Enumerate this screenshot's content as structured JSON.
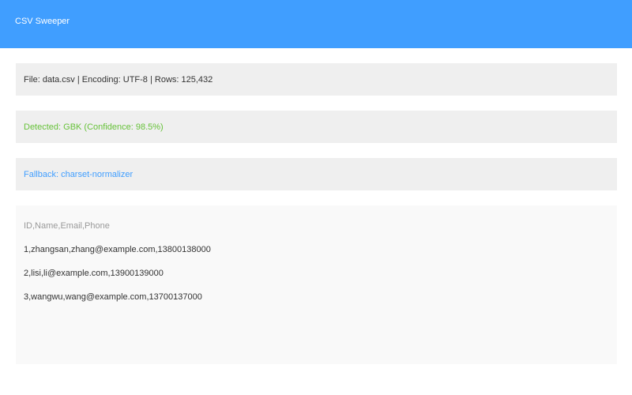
{
  "app": {
    "title": "CSV Sweeper"
  },
  "file_info": {
    "text": "File: data.csv | Encoding: UTF-8 | Rows: 125,432"
  },
  "detection": {
    "text": "Detected: GBK (Confidence: 98.5%)"
  },
  "fallback": {
    "text": "Fallback: charset-normalizer"
  },
  "preview": {
    "header": "ID,Name,Email,Phone",
    "rows": [
      "1,zhangsan,zhang@example.com,13800138000",
      "2,lisi,li@example.com,13900139000",
      "3,wangwu,wang@example.com,13700137000"
    ]
  },
  "colors": {
    "header_bg": "#409EFF",
    "success": "#67C23A",
    "info": "#409EFF",
    "panel_bg": "#efefef",
    "preview_bg": "#f9f9f9"
  }
}
